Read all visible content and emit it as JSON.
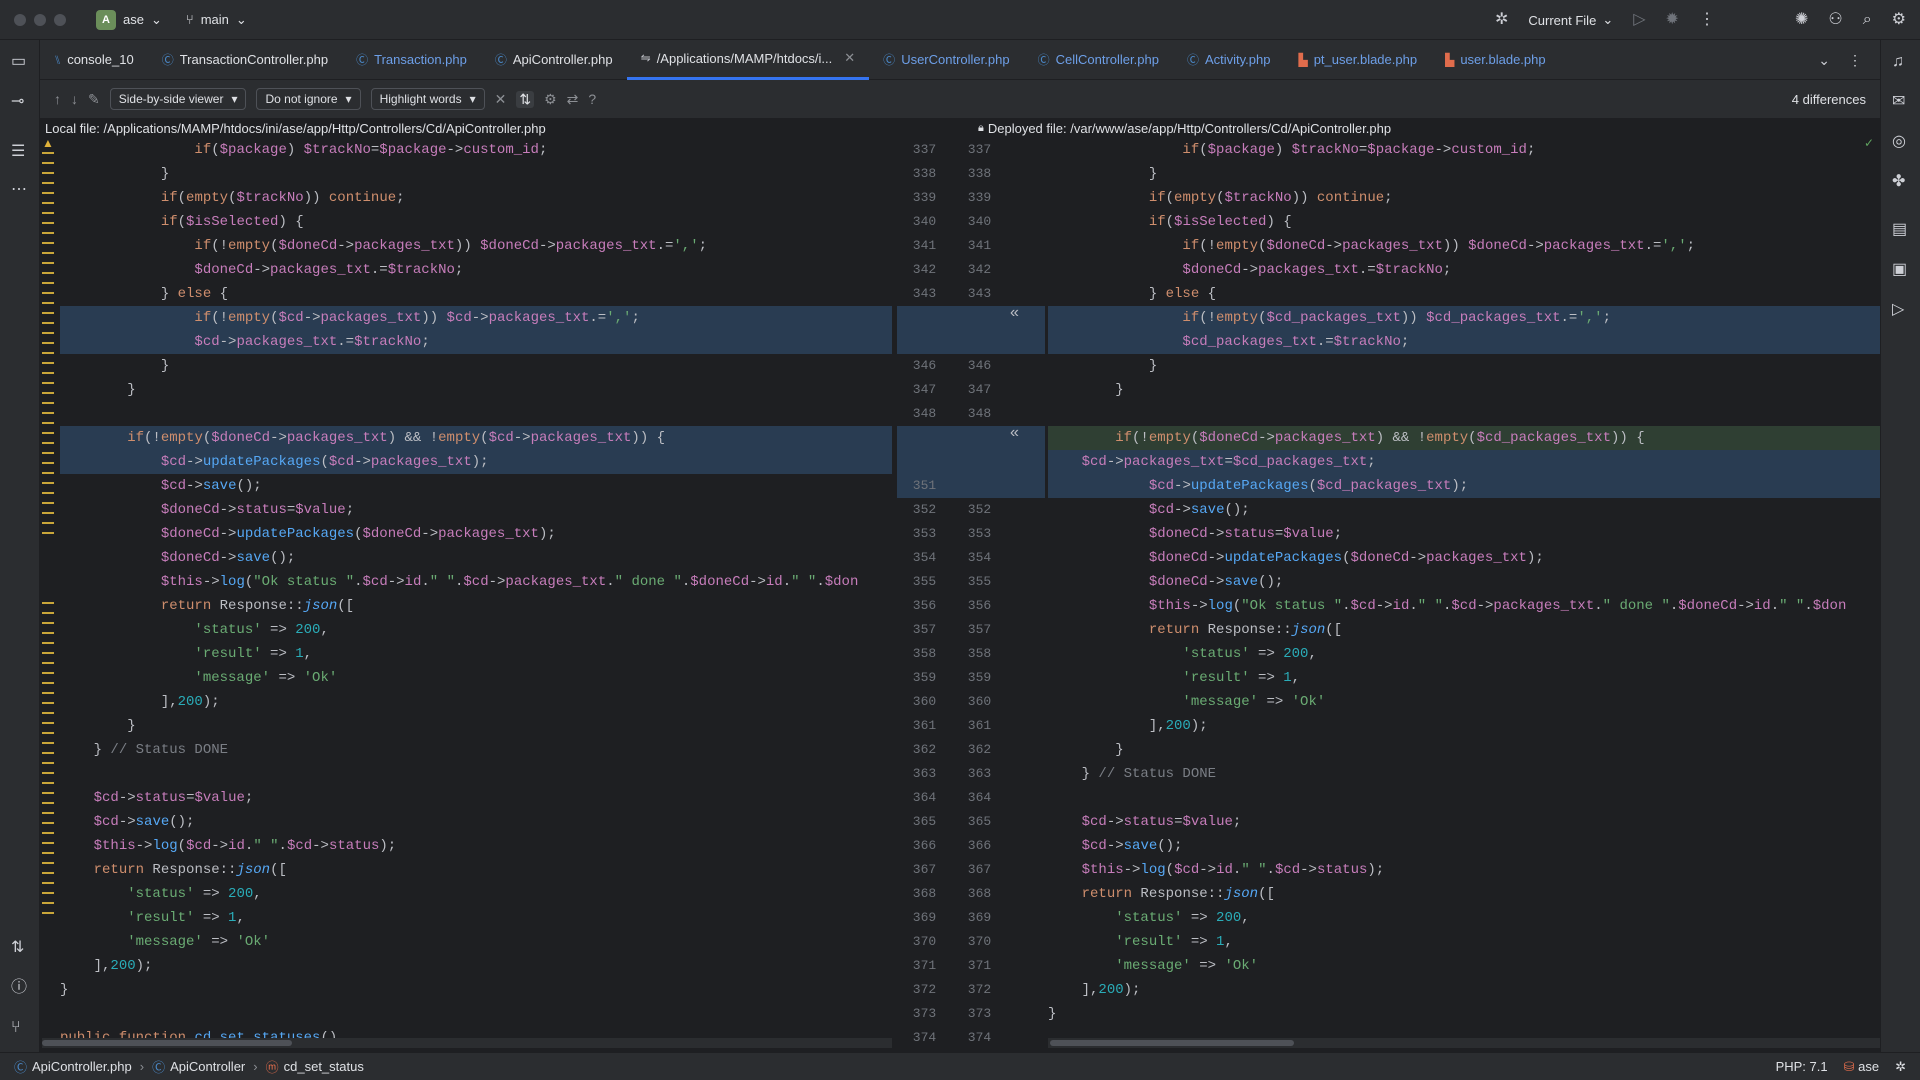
{
  "titlebar": {
    "project_initial": "A",
    "project_name": "ase",
    "branch": "main",
    "run_config": "Current File"
  },
  "tabs": [
    {
      "label": "console_10"
    },
    {
      "label": "TransactionController.php"
    },
    {
      "label": "Transaction.php"
    },
    {
      "label": "ApiController.php"
    },
    {
      "label": "/Applications/MAMP/htdocs/i..."
    },
    {
      "label": "UserController.php"
    },
    {
      "label": "CellController.php"
    },
    {
      "label": "Activity.php"
    },
    {
      "label": "pt_user.blade.php"
    },
    {
      "label": "user.blade.php"
    }
  ],
  "toolbar": {
    "viewer": "Side-by-side viewer",
    "ignore": "Do not ignore",
    "highlight": "Highlight words",
    "differences": "4 differences"
  },
  "local_file": "Local file: /Applications/MAMP/htdocs/ini/ase/app/Http/Controllers/Cd/ApiController.php",
  "deployed_file": "Deployed file: /var/www/ase/app/Http/Controllers/Cd/ApiController.php",
  "statusbar": {
    "file": "ApiController.php",
    "class": "ApiController",
    "method": "cd_set_status",
    "php": "PHP: 7.1",
    "user": "ase"
  },
  "line_numbers_left": [
    "337",
    "338",
    "339",
    "340",
    "341",
    "342",
    "343",
    "",
    "",
    "346",
    "347",
    "348",
    "",
    "",
    "351",
    "352",
    "353",
    "354",
    "355",
    "356",
    "357",
    "358",
    "359",
    "360",
    "361",
    "362",
    "363",
    "364",
    "365",
    "366",
    "367",
    "368",
    "369",
    "370",
    "371",
    "372",
    "373",
    "374"
  ],
  "line_numbers_right": [
    "337",
    "338",
    "339",
    "340",
    "341",
    "342",
    "343",
    "",
    "",
    "346",
    "347",
    "348",
    "",
    "",
    "",
    "352",
    "353",
    "354",
    "355",
    "356",
    "357",
    "358",
    "359",
    "360",
    "361",
    "362",
    "363",
    "364",
    "365",
    "366",
    "367",
    "368",
    "369",
    "370",
    "371",
    "372",
    "373",
    "374"
  ]
}
